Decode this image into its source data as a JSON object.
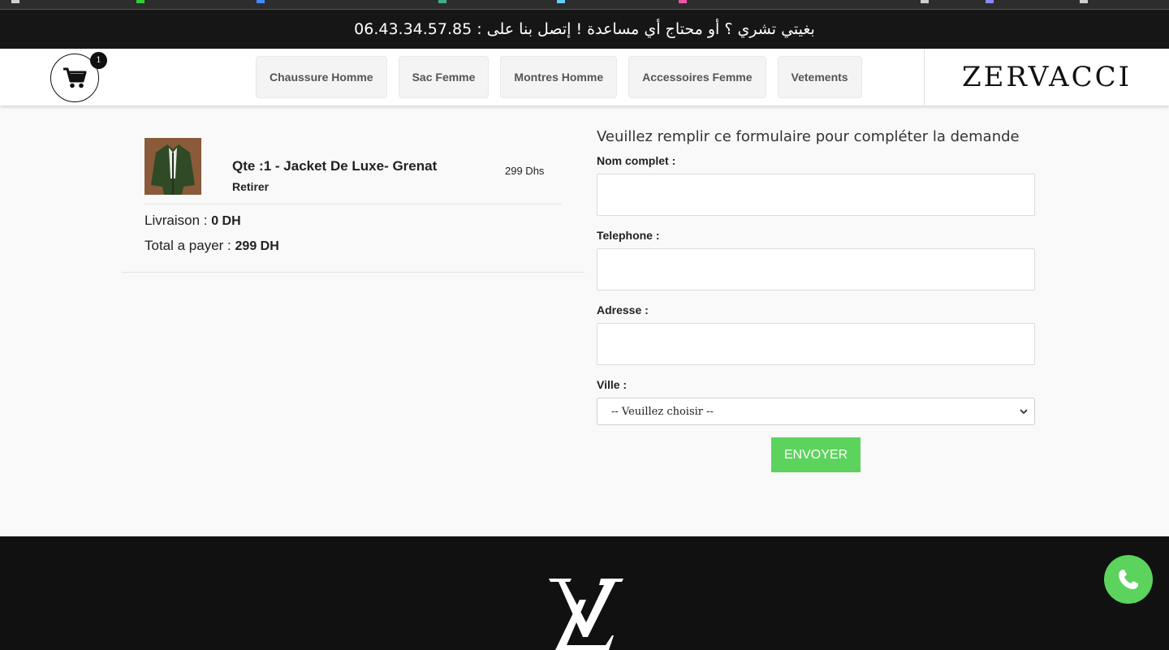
{
  "announcement": "بغيتي تشري ؟ أو محتاج أي مساعدة ! إتصل بنا على : 06.43.34.57.85",
  "header": {
    "cart_count": "1",
    "nav": [
      "Chaussure Homme",
      "Sac Femme",
      "Montres Homme",
      "Accessoires Femme",
      "Vetements"
    ],
    "brand": "ZERVACCI"
  },
  "cart": {
    "item_title": "Qte :1 - Jacket De Luxe- Grenat",
    "remove_label": "Retirer",
    "price": "299 Dhs",
    "delivery_label": "Livraison : ",
    "delivery_value": "0 DH",
    "total_label": "Total a payer : ",
    "total_value": "299  DH"
  },
  "form": {
    "title": "Veuillez remplir ce formulaire pour compléter la demande",
    "name_label": "Nom complet :",
    "phone_label": "Telephone :",
    "address_label": "Adresse :",
    "city_label": "Ville :",
    "city_selected": "-- Veuillez choisir --",
    "submit_label": "ENVOYER"
  },
  "colors": {
    "accent_green": "#5cd35c",
    "dark": "#111111"
  },
  "icons": [
    "cart-icon",
    "phone-icon",
    "chevron-down-icon",
    "footer-logo"
  ]
}
